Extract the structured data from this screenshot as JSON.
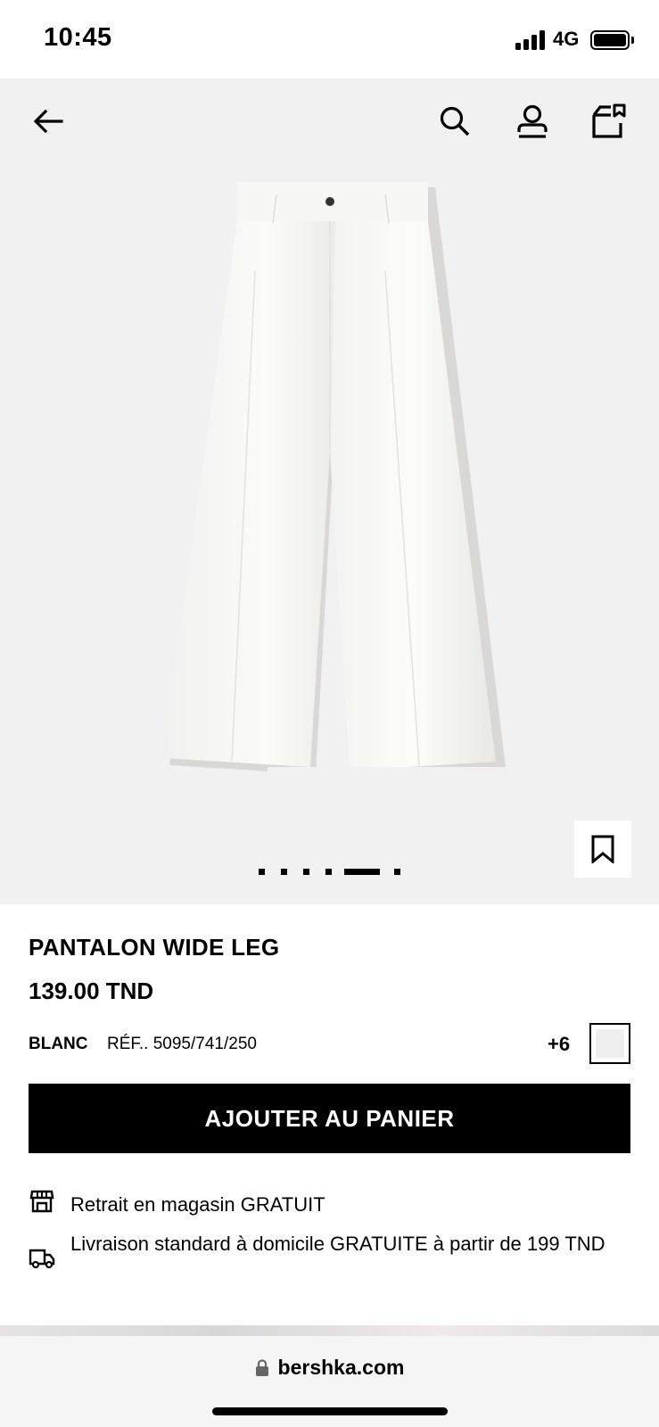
{
  "status_bar": {
    "time": "10:45",
    "network": "4G"
  },
  "nav": {
    "back_icon": "arrow-left-icon",
    "search_icon": "search-icon",
    "account_icon": "user-icon",
    "bag_icon": "shopping-bag-icon"
  },
  "gallery": {
    "image_count": 6,
    "active_index": 5
  },
  "product": {
    "title": "PANTALON WIDE LEG",
    "price": "139.00 TND",
    "color": "BLANC",
    "reference": "RÉF.. 5095/741/250",
    "more_colors": "+6"
  },
  "cart_button": {
    "label": "AJOUTER AU PANIER"
  },
  "delivery": {
    "store_pickup": "Retrait en magasin GRATUIT",
    "home_delivery": "Livraison standard à domicile GRATUITE à partir de 199 TND"
  },
  "browser": {
    "url": "bershka.com"
  },
  "colors": {
    "accent": "#000000",
    "background": "#f2f1f1",
    "swatch": "#efefef"
  }
}
